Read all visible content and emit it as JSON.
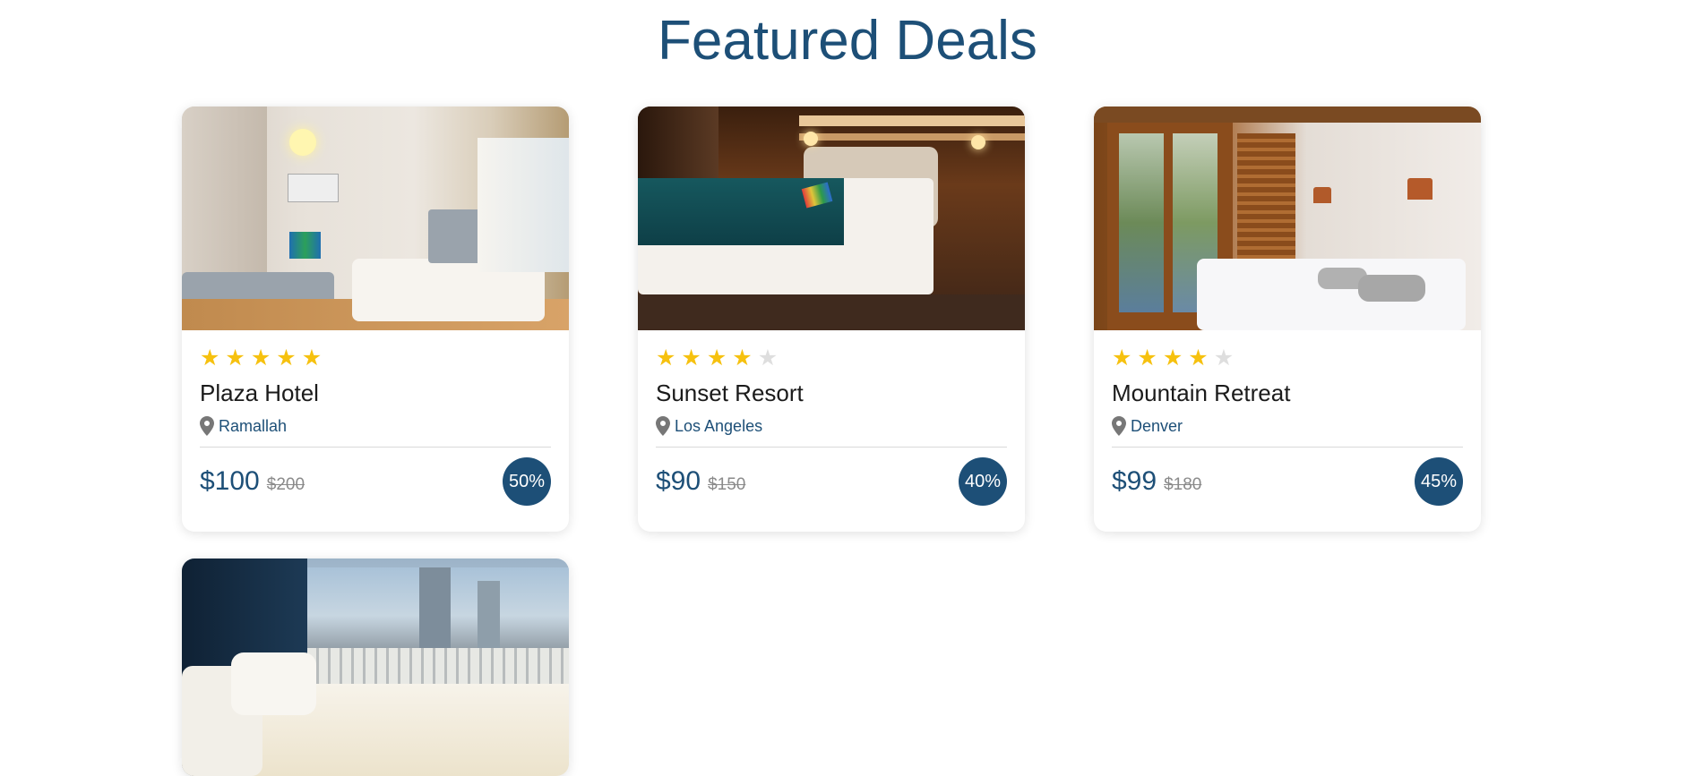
{
  "page": {
    "title": "Featured Deals"
  },
  "colors": {
    "primary": "#1d4f77",
    "star_on": "#f6c10f",
    "star_off": "#dedede"
  },
  "icons": {
    "star": "star-icon",
    "location": "map-pin-icon"
  },
  "deals": [
    {
      "name": "Plaza Hotel",
      "location": "Ramallah",
      "rating": 5,
      "max_rating": 5,
      "price": "$100",
      "old_price": "$200",
      "discount": "50%"
    },
    {
      "name": "Sunset Resort",
      "location": "Los Angeles",
      "rating": 4,
      "max_rating": 5,
      "price": "$90",
      "old_price": "$150",
      "discount": "40%"
    },
    {
      "name": "Mountain Retreat",
      "location": "Denver",
      "rating": 4,
      "max_rating": 5,
      "price": "$99",
      "old_price": "$180",
      "discount": "45%"
    }
  ]
}
